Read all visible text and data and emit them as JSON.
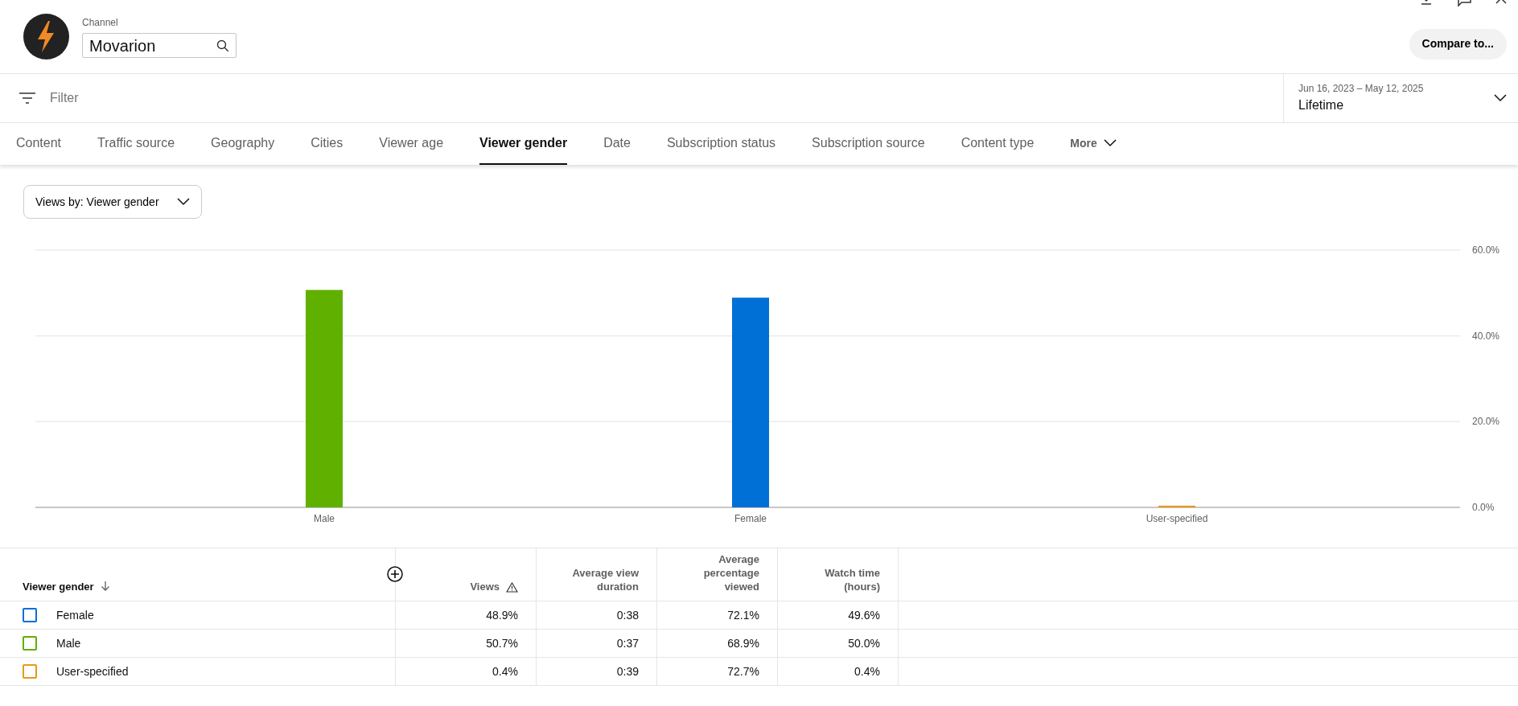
{
  "header": {
    "channel_label": "Channel",
    "channel_name": "Movarion",
    "compare_button": "Compare to..."
  },
  "filter": {
    "placeholder": "Filter"
  },
  "date_range": {
    "range": "Jun 16, 2023 – May 12, 2025",
    "period": "Lifetime"
  },
  "tabs": [
    {
      "label": "Content",
      "selected": false
    },
    {
      "label": "Traffic source",
      "selected": false
    },
    {
      "label": "Geography",
      "selected": false
    },
    {
      "label": "Cities",
      "selected": false
    },
    {
      "label": "Viewer age",
      "selected": false
    },
    {
      "label": "Viewer gender",
      "selected": true
    },
    {
      "label": "Date",
      "selected": false
    },
    {
      "label": "Subscription status",
      "selected": false
    },
    {
      "label": "Subscription source",
      "selected": false
    },
    {
      "label": "Content type",
      "selected": false
    }
  ],
  "more_menu": {
    "label": "More"
  },
  "metric_dropdown": {
    "value": "Views by: Viewer gender"
  },
  "chart": {
    "chart_data": {
      "type": "bar",
      "series": [
        {
          "name": "Male",
          "color": "#60b000",
          "values": [
            50.7
          ]
        },
        {
          "name": "Female",
          "color": "#0070d6",
          "values": [
            48.9
          ]
        },
        {
          "name": "User-specified",
          "color": "#e69a1c",
          "values": [
            0.4
          ]
        }
      ],
      "ylim": [
        0,
        60
      ],
      "yticks": [
        {
          "value": 0,
          "label": "0.0%"
        },
        {
          "value": 20,
          "label": "20.0%"
        },
        {
          "value": 40,
          "label": "40.0%"
        },
        {
          "value": 60,
          "label": "60.0%"
        }
      ]
    }
  },
  "table": {
    "columns": [
      {
        "label": "Viewer gender",
        "kind": "dimension"
      },
      {
        "label": "Views",
        "kind": "warning"
      },
      {
        "label": "Average view duration",
        "kind": "plain"
      },
      {
        "label": "Average percentage viewed",
        "kind": "plain"
      },
      {
        "label": "Watch time (hours)",
        "kind": "plain"
      }
    ],
    "rows": [
      {
        "color": "#0b6ed6",
        "cells": [
          "Female",
          "48.9%",
          "0:38",
          "72.1%",
          "49.6%"
        ]
      },
      {
        "color": "#60b000",
        "cells": [
          "Male",
          "50.7%",
          "0:37",
          "68.9%",
          "50.0%"
        ]
      },
      {
        "color": "#e69a1c",
        "cells": [
          "User-specified",
          "0.4%",
          "0:39",
          "72.7%",
          "0.4%"
        ]
      }
    ]
  }
}
